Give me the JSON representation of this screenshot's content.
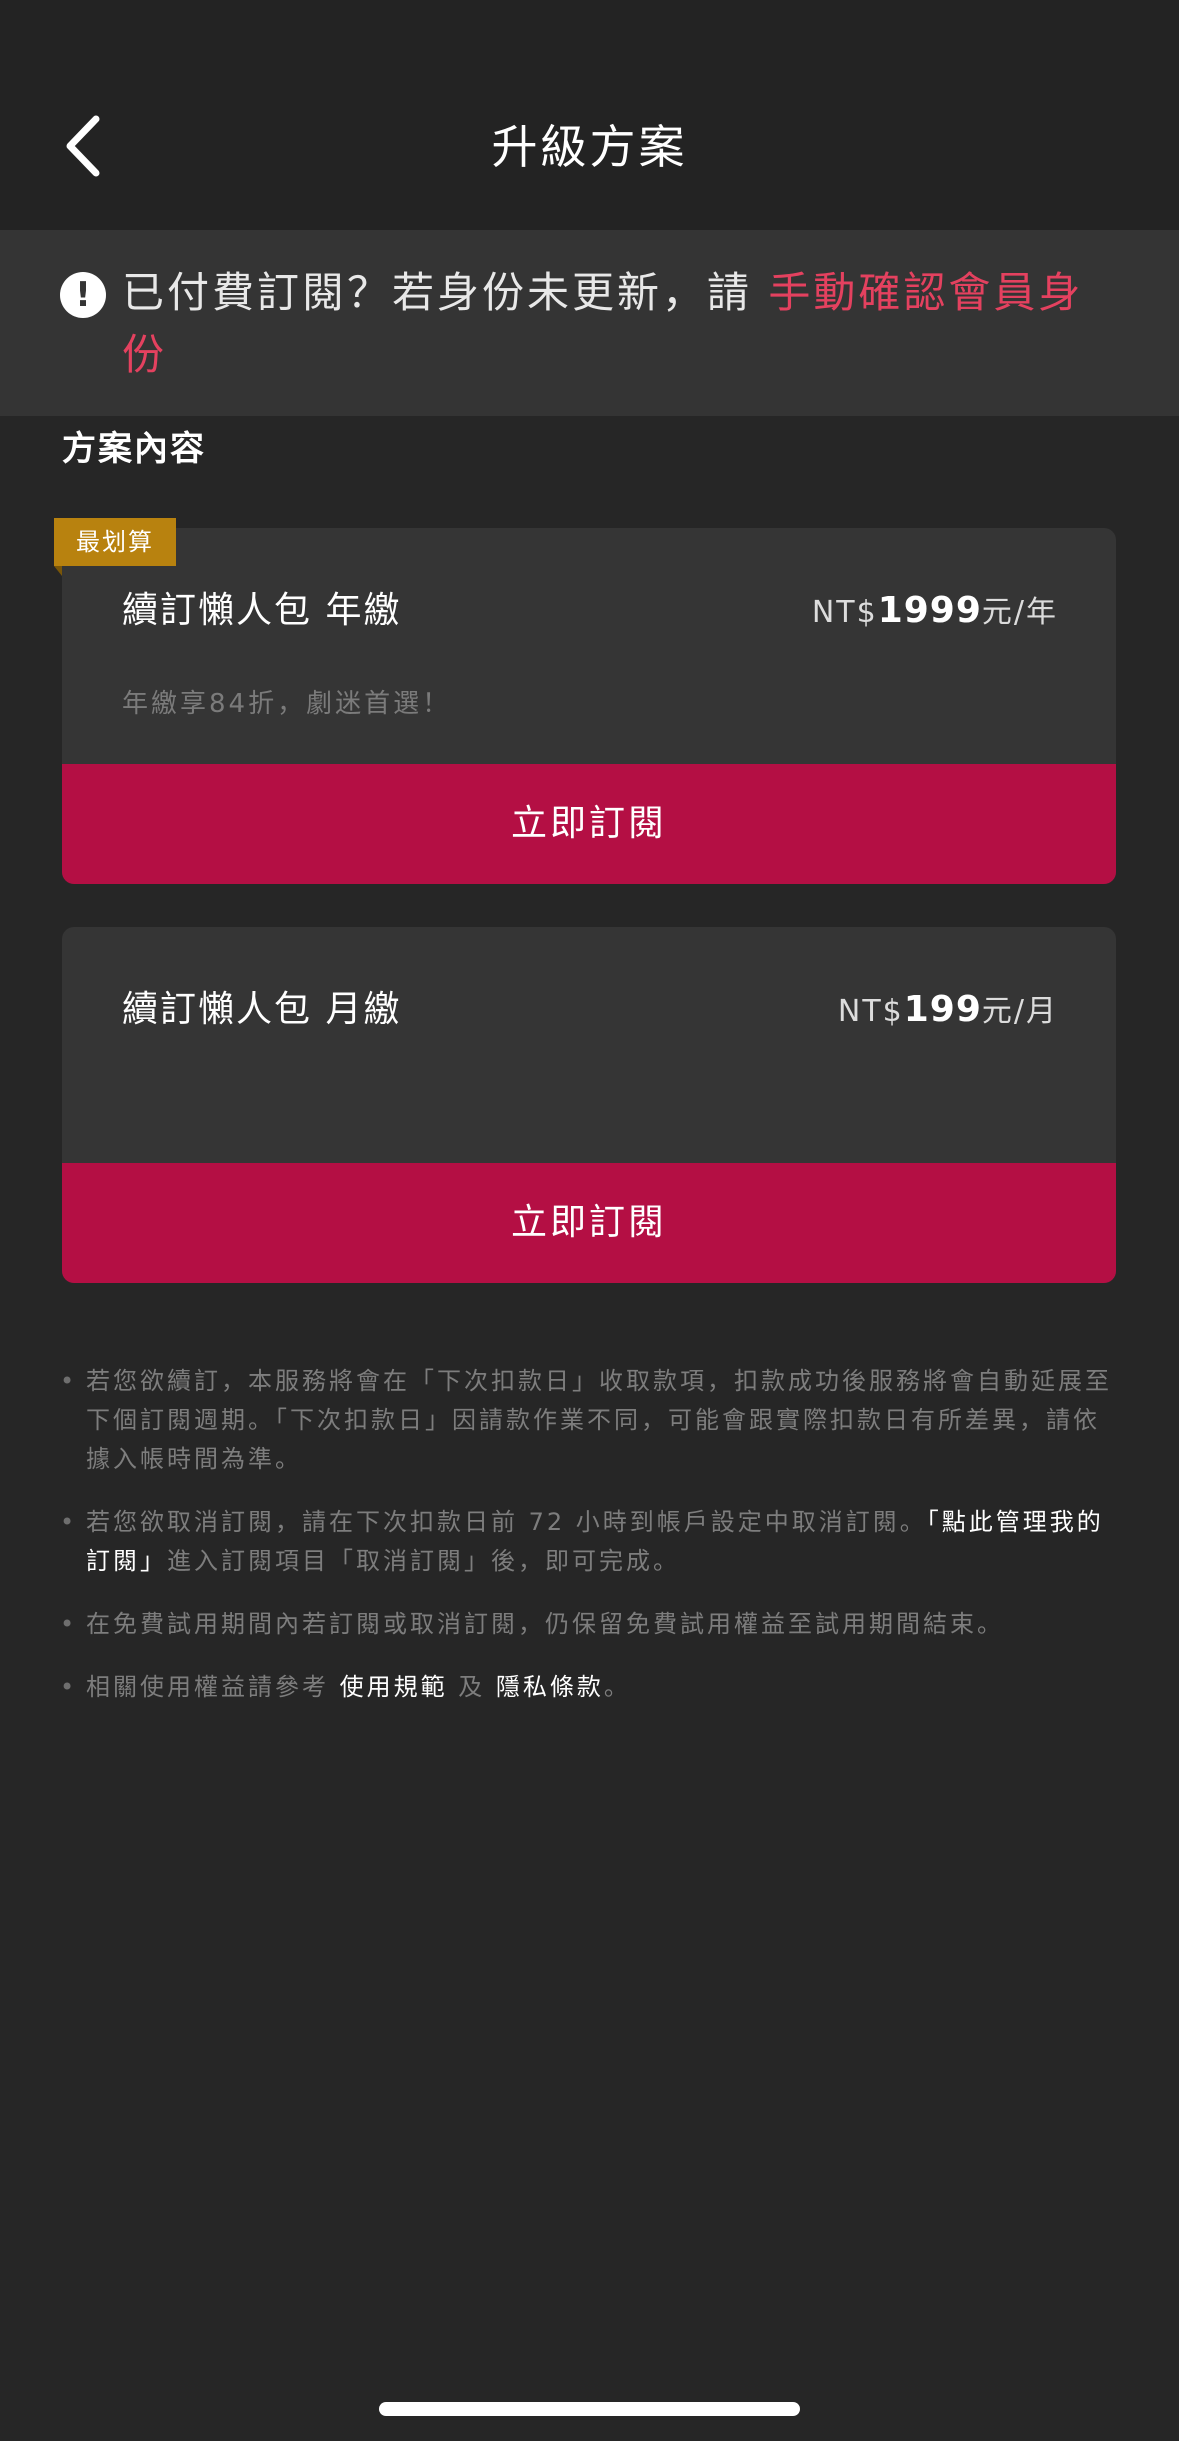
{
  "header": {
    "back_icon": "chevron-left-icon",
    "title": "升級方案"
  },
  "notice": {
    "icon": "exclamation-circle-icon",
    "text": "已付費訂閱？若身份未更新，請 ",
    "link": "手動確認會員身份"
  },
  "section": {
    "title": "方案內容"
  },
  "plans": [
    {
      "badge": "最划算",
      "name": "續訂懶人包 年繳",
      "price_prefix": "NT$",
      "price_amount": "1999",
      "price_suffix": "元/年",
      "note": "年繳享84折，劇迷首選！",
      "button": "立即訂閱"
    },
    {
      "name": "續訂懶人包 月繳",
      "price_prefix": "NT$",
      "price_amount": "199",
      "price_suffix": "元/月",
      "button": "立即訂閱"
    }
  ],
  "terms": {
    "bullet": "•",
    "item1": "若您欲續訂，本服務將會在「下次扣款日」收取款項，扣款成功後服務將會自動延展至下個訂閱週期。「下次扣款日」因請款作業不同，可能會跟實際扣款日有所差異，請依據入帳時間為準。",
    "item2_before": "若您欲取消訂閱，請在下次扣款日前 72 小時到帳戶設定中取消訂閱。",
    "item2_link": "「點此管理我的訂閱」",
    "item2_after": "進入訂閱項目「取消訂閱」後，即可完成。",
    "item3": "在免費試用期間內若訂閱或取消訂閱，仍保留免費試用權益至試用期間結束。",
    "item4_before": "相關使用權益請參考 ",
    "item4_link1": "使用規範",
    "item4_middle": " 及 ",
    "item4_link2": "隱私條款",
    "item4_after": "。"
  },
  "colors": {
    "background": "#262626",
    "accent_button": "#b40f44",
    "notice_link": "#e4415f",
    "badge": "#b8820f"
  }
}
